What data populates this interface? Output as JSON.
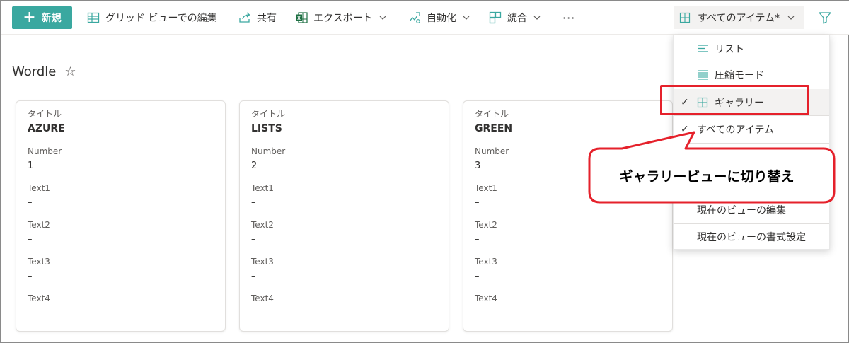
{
  "toolbar": {
    "new_label": "新規",
    "grid_edit_label": "グリッド ビューでの編集",
    "share_label": "共有",
    "export_label": "エクスポート",
    "automate_label": "自動化",
    "integrate_label": "統合",
    "more_label": "···",
    "view_selector_label": "すべてのアイテム*"
  },
  "list": {
    "title": "Wordle",
    "star": "☆"
  },
  "cards": [
    {
      "title_label": "タイトル",
      "title": "AZURE",
      "number_label": "Number",
      "number": "1",
      "text1_label": "Text1",
      "text1": "–",
      "text2_label": "Text2",
      "text2": "–",
      "text3_label": "Text3",
      "text3": "–",
      "text4_label": "Text4",
      "text4": "–"
    },
    {
      "title_label": "タイトル",
      "title": "LISTS",
      "number_label": "Number",
      "number": "2",
      "text1_label": "Text1",
      "text1": "–",
      "text2_label": "Text2",
      "text2": "–",
      "text3_label": "Text3",
      "text3": "–",
      "text4_label": "Text4",
      "text4": "–"
    },
    {
      "title_label": "タイトル",
      "title": "GREEN",
      "number_label": "Number",
      "number": "3",
      "text1_label": "Text1",
      "text1": "–",
      "text2_label": "Text2",
      "text2": "–",
      "text3_label": "Text3",
      "text3": "–",
      "text4_label": "Text4",
      "text4": "–"
    }
  ],
  "view_menu": {
    "items": [
      {
        "label": "リスト"
      },
      {
        "label": "圧縮モード"
      },
      {
        "label": "ギャラリー",
        "check": "✓"
      },
      {
        "label": "すべてのアイテム",
        "check": "✓"
      },
      {
        "label": "現在のビューの編集"
      },
      {
        "label": "現在のビューの書式設定"
      }
    ]
  },
  "callout": {
    "text": "ギャラリービューに切り替え"
  },
  "colors": {
    "accent": "#3aa8a0",
    "icon_teal": "#3aa8a0",
    "excel_green": "#1d6f42",
    "highlight_red": "#e5212b"
  }
}
